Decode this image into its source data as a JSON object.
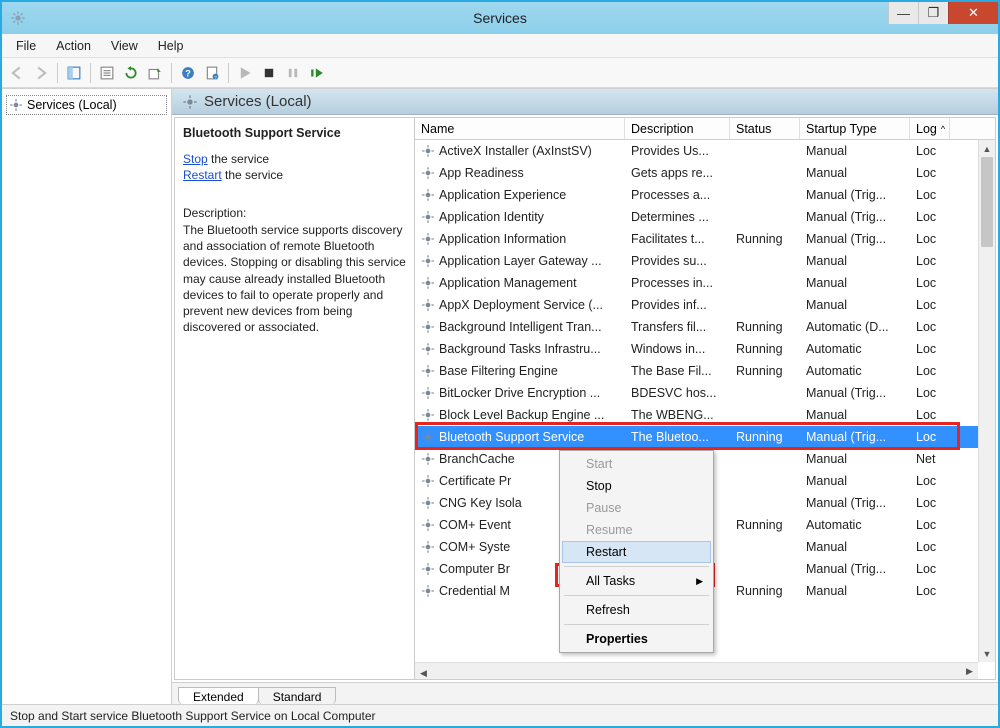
{
  "window": {
    "title": "Services"
  },
  "menus": {
    "file": "File",
    "action": "Action",
    "view": "View",
    "help": "Help"
  },
  "tree": {
    "root": "Services (Local)"
  },
  "content_header": "Services (Local)",
  "desc_pane": {
    "title": "Bluetooth Support Service",
    "stop_link": "Stop",
    "stop_suffix": " the service",
    "restart_link": "Restart",
    "restart_suffix": " the service",
    "desc_label": "Description:",
    "desc_text": "The Bluetooth service supports discovery and association of remote Bluetooth devices.  Stopping or disabling this service may cause already installed Bluetooth devices to fail to operate properly and prevent new devices from being discovered or associated."
  },
  "columns": {
    "name": "Name",
    "description": "Description",
    "status": "Status",
    "startup": "Startup Type",
    "logon": "Log"
  },
  "rows": [
    {
      "name": "ActiveX Installer (AxInstSV)",
      "desc": "Provides Us...",
      "status": "",
      "startup": "Manual",
      "log": "Loc"
    },
    {
      "name": "App Readiness",
      "desc": "Gets apps re...",
      "status": "",
      "startup": "Manual",
      "log": "Loc"
    },
    {
      "name": "Application Experience",
      "desc": "Processes a...",
      "status": "",
      "startup": "Manual (Trig...",
      "log": "Loc"
    },
    {
      "name": "Application Identity",
      "desc": "Determines ...",
      "status": "",
      "startup": "Manual (Trig...",
      "log": "Loc"
    },
    {
      "name": "Application Information",
      "desc": "Facilitates t...",
      "status": "Running",
      "startup": "Manual (Trig...",
      "log": "Loc"
    },
    {
      "name": "Application Layer Gateway ...",
      "desc": "Provides su...",
      "status": "",
      "startup": "Manual",
      "log": "Loc"
    },
    {
      "name": "Application Management",
      "desc": "Processes in...",
      "status": "",
      "startup": "Manual",
      "log": "Loc"
    },
    {
      "name": "AppX Deployment Service (...",
      "desc": "Provides inf...",
      "status": "",
      "startup": "Manual",
      "log": "Loc"
    },
    {
      "name": "Background Intelligent Tran...",
      "desc": "Transfers fil...",
      "status": "Running",
      "startup": "Automatic (D...",
      "log": "Loc"
    },
    {
      "name": "Background Tasks Infrastru...",
      "desc": "Windows in...",
      "status": "Running",
      "startup": "Automatic",
      "log": "Loc"
    },
    {
      "name": "Base Filtering Engine",
      "desc": "The Base Fil...",
      "status": "Running",
      "startup": "Automatic",
      "log": "Loc"
    },
    {
      "name": "BitLocker Drive Encryption ...",
      "desc": "BDESVC hos...",
      "status": "",
      "startup": "Manual (Trig...",
      "log": "Loc"
    },
    {
      "name": "Block Level Backup Engine ...",
      "desc": "The WBENG...",
      "status": "",
      "startup": "Manual",
      "log": "Loc"
    },
    {
      "name": "Bluetooth Support Service",
      "desc": "The Bluetoo...",
      "status": "Running",
      "startup": "Manual (Trig...",
      "log": "Loc"
    },
    {
      "name": "BranchCache",
      "desc": "",
      "status": "",
      "startup": "Manual",
      "log": "Net"
    },
    {
      "name": "Certificate Pr",
      "desc": "",
      "status": "",
      "startup": "Manual",
      "log": "Loc"
    },
    {
      "name": "CNG Key Isola",
      "desc": "",
      "status": "",
      "startup": "Manual (Trig...",
      "log": "Loc"
    },
    {
      "name": "COM+ Event",
      "desc": "",
      "status": "Running",
      "startup": "Automatic",
      "log": "Loc"
    },
    {
      "name": "COM+ Syste",
      "desc": "",
      "status": "",
      "startup": "Manual",
      "log": "Loc"
    },
    {
      "name": "Computer Br",
      "desc": "",
      "status": "",
      "startup": "Manual (Trig...",
      "log": "Loc"
    },
    {
      "name": "Credential M",
      "desc": "",
      "status": "Running",
      "startup": "Manual",
      "log": "Loc"
    }
  ],
  "selected_index": 13,
  "context_menu": {
    "start": "Start",
    "stop": "Stop",
    "pause": "Pause",
    "resume": "Resume",
    "restart": "Restart",
    "all_tasks": "All Tasks",
    "refresh": "Refresh",
    "properties": "Properties"
  },
  "tabs": {
    "extended": "Extended",
    "standard": "Standard"
  },
  "statusbar": "Stop and Start service Bluetooth Support Service on Local Computer"
}
